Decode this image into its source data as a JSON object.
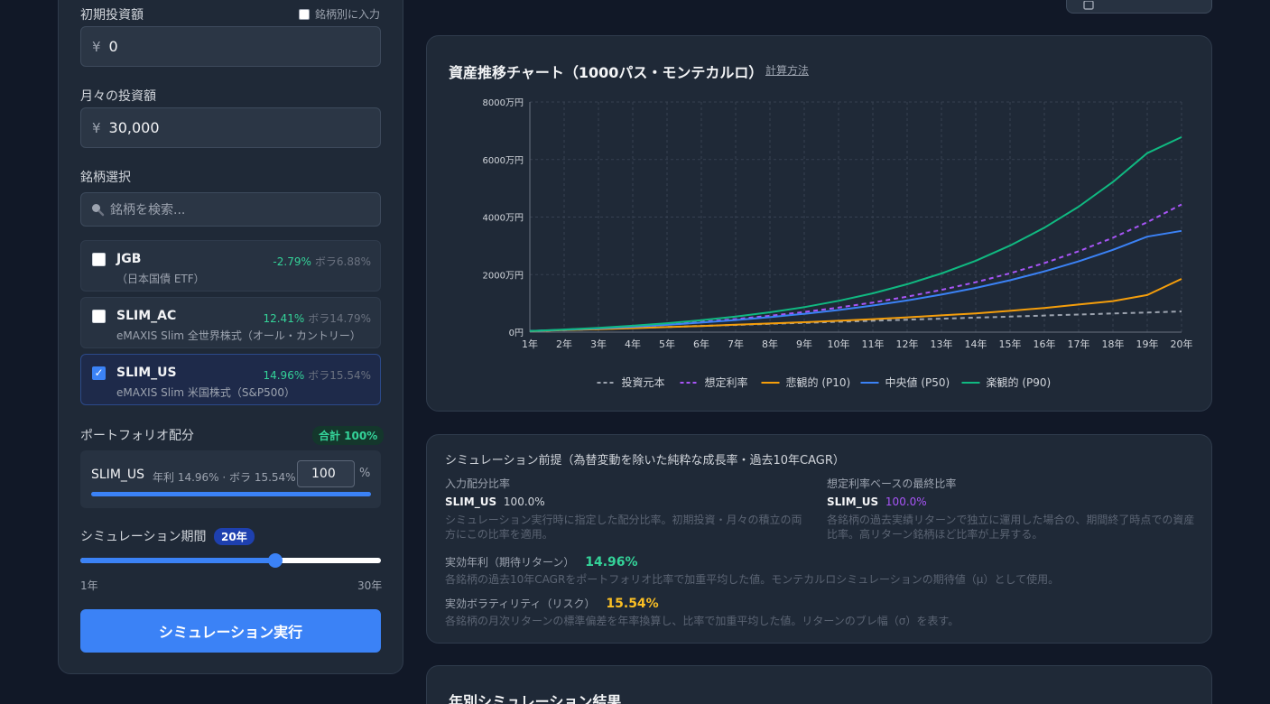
{
  "left": {
    "initial_label": "初期投資額",
    "per_fund_label": "銘柄別に入力",
    "initial_currency": "¥",
    "initial_value": "0",
    "monthly_label": "月々の投資額",
    "monthly_currency": "¥",
    "monthly_value": "30,000",
    "funds_label": "銘柄選択",
    "search_placeholder": "銘柄を検索...",
    "funds": [
      {
        "ticker": "JGB",
        "name": "（日本国債 ETF）",
        "ret": "-2.79%",
        "vol": "ボラ6.88%",
        "checked": false
      },
      {
        "ticker": "SLIM_AC",
        "name": "eMAXIS Slim 全世界株式（オール・カントリー）",
        "ret": "12.41%",
        "vol": "ボラ14.79%",
        "checked": false
      },
      {
        "ticker": "SLIM_US",
        "name": "eMAXIS Slim 米国株式（S&P500）",
        "ret": "14.96%",
        "vol": "ボラ15.54%",
        "checked": true
      }
    ],
    "alloc_label": "ポートフォリオ配分",
    "alloc_total": "合計 100%",
    "alloc_ticker": "SLIM_US",
    "alloc_meta": "年利 14.96% · ボラ 15.54%",
    "alloc_value": "100",
    "alloc_unit": "%",
    "alloc_fraction": 1.0,
    "period_label": "シミュレーション期間",
    "period_badge": "20年",
    "period_min": "1年",
    "period_max": "30年",
    "period_value": 20,
    "period_range": [
      1,
      30
    ],
    "run_label": "シミュレーション実行"
  },
  "chart_panel": {
    "title": "資産推移チャート（1000パス・モンテカルロ）",
    "calc_link": "計算方法"
  },
  "chart_data": {
    "type": "line",
    "x": [
      "1年",
      "2年",
      "3年",
      "4年",
      "5年",
      "6年",
      "7年",
      "8年",
      "9年",
      "10年",
      "11年",
      "12年",
      "13年",
      "14年",
      "15年",
      "16年",
      "17年",
      "18年",
      "19年",
      "20年"
    ],
    "ylim": [
      0,
      8000
    ],
    "yticks": [
      0,
      2000,
      4000,
      6000,
      8000
    ],
    "ytick_labels": [
      "0円",
      "2000万円",
      "4000万円",
      "6000万円",
      "8000万円"
    ],
    "unit": "万円",
    "grid": true,
    "legend_position": "bottom",
    "series": [
      {
        "name": "投資元本",
        "color": "#9ca3af",
        "dash": true,
        "values": [
          36,
          72,
          108,
          144,
          180,
          216,
          252,
          288,
          324,
          360,
          396,
          432,
          468,
          504,
          540,
          576,
          612,
          648,
          684,
          720
        ]
      },
      {
        "name": "想定利率",
        "color": "#a855f7",
        "dash": true,
        "values": [
          38,
          82,
          135,
          197,
          270,
          355,
          454,
          568,
          701,
          854,
          1030,
          1233,
          1467,
          1735,
          2044,
          2400,
          2810,
          3280,
          3820,
          4440
        ]
      },
      {
        "name": "悲観的 (P10)",
        "color": "#f59e0b",
        "dash": false,
        "values": [
          35,
          68,
          102,
          138,
          176,
          214,
          256,
          300,
          346,
          396,
          452,
          514,
          582,
          654,
          740,
          840,
          960,
          1080,
          1290,
          1850
        ]
      },
      {
        "name": "中央値 (P50)",
        "color": "#3b82f6",
        "dash": false,
        "values": [
          37,
          80,
          130,
          188,
          255,
          332,
          420,
          520,
          636,
          770,
          924,
          1102,
          1304,
          1538,
          1804,
          2110,
          2460,
          2860,
          3320,
          3520
        ]
      },
      {
        "name": "楽観的 (P90)",
        "color": "#10b981",
        "dash": false,
        "values": [
          40,
          90,
          150,
          222,
          310,
          414,
          540,
          690,
          870,
          1088,
          1350,
          1666,
          2040,
          2480,
          3010,
          3630,
          4360,
          5220,
          6220,
          6780
        ]
      }
    ]
  },
  "assumptions": {
    "title": "シミュレーション前提（為替変動を除いた純粋な成長率・過去10年CAGR）",
    "input_label": "入力配分比率",
    "input_ticker": "SLIM_US",
    "input_value": "100.0%",
    "input_desc": "シミュレーション実行時に指定した配分比率。初期投資・月々の積立の両方にこの比率を適用。",
    "final_label": "想定利率ベースの最終比率",
    "final_ticker": "SLIM_US",
    "final_value": "100.0%",
    "final_desc": "各銘柄の過去実績リターンで独立に運用した場合の、期間終了時点での資産比率。高リターン銘柄ほど比率が上昇する。",
    "ret_label": "実効年利（期待リターン）",
    "ret_value": "14.96%",
    "ret_desc": "各銘柄の過去10年CAGRをポートフォリオ比率で加重平均した値。モンテカルロシミュレーションの期待値（μ）として使用。",
    "vol_label": "実効ボラティリティ（リスク）",
    "vol_value": "15.54%",
    "vol_desc": "各銘柄の月次リターンの標準偏差を年率換算し、比率で加重平均した値。リターンのブレ幅（σ）を表す。"
  },
  "yearly": {
    "title": "年別シミュレーション結果"
  },
  "colors": {
    "accent": "#3b82f6",
    "positive": "#34d399",
    "warning": "#fbbf24",
    "purple": "#a855f7"
  }
}
